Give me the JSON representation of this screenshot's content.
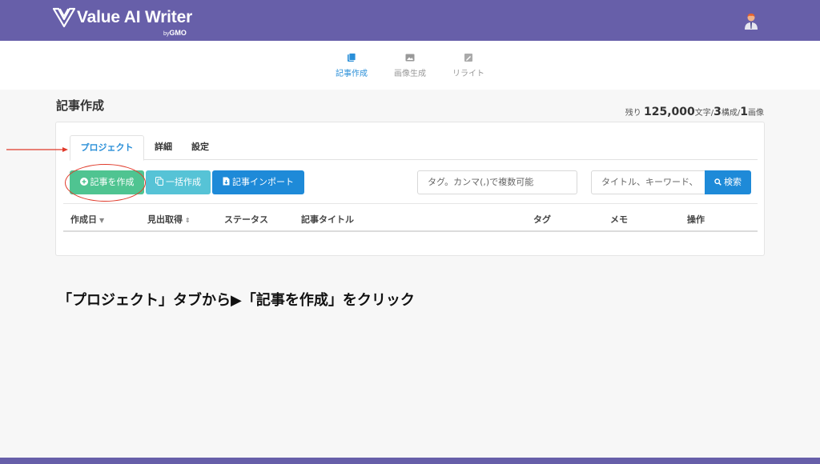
{
  "header": {
    "logo_text": "Value AI Writer",
    "logo_by": "by",
    "logo_company": "GMO",
    "brand_color": "#675fa9"
  },
  "subnav": {
    "items": [
      {
        "label": "記事作成",
        "icon": "article-icon",
        "active": true
      },
      {
        "label": "画像生成",
        "icon": "image-icon",
        "active": false
      },
      {
        "label": "リライト",
        "icon": "rewrite-icon",
        "active": false
      }
    ]
  },
  "page": {
    "title": "記事作成",
    "quota": {
      "prefix": "残り",
      "chars": "125,000",
      "chars_unit": "文字/",
      "outlines": "3",
      "outlines_unit": "構成/",
      "images": "1",
      "images_unit": "画像"
    }
  },
  "tabs": [
    {
      "label": "プロジェクト",
      "active": true
    },
    {
      "label": "詳細",
      "active": false
    },
    {
      "label": "設定",
      "active": false
    }
  ],
  "toolbar": {
    "create_label": "記事を作成",
    "bulk_label": "一括作成",
    "import_label": "記事インポート",
    "tags_placeholder": "タグ。カンマ(,)で複数可能",
    "search_placeholder": "タイトル、キーワード、",
    "search_label": "検索",
    "colors": {
      "create": "#4fc491",
      "bulk": "#56c3d6",
      "primary": "#1e8ad8"
    }
  },
  "table": {
    "columns": [
      "作成日",
      "見出取得",
      "ステータス",
      "記事タイトル",
      "タグ",
      "メモ",
      "操作"
    ]
  },
  "annotation": {
    "instruction": "「プロジェクト」タブから▶「記事を作成」をクリック",
    "color": "#e03a2a"
  }
}
